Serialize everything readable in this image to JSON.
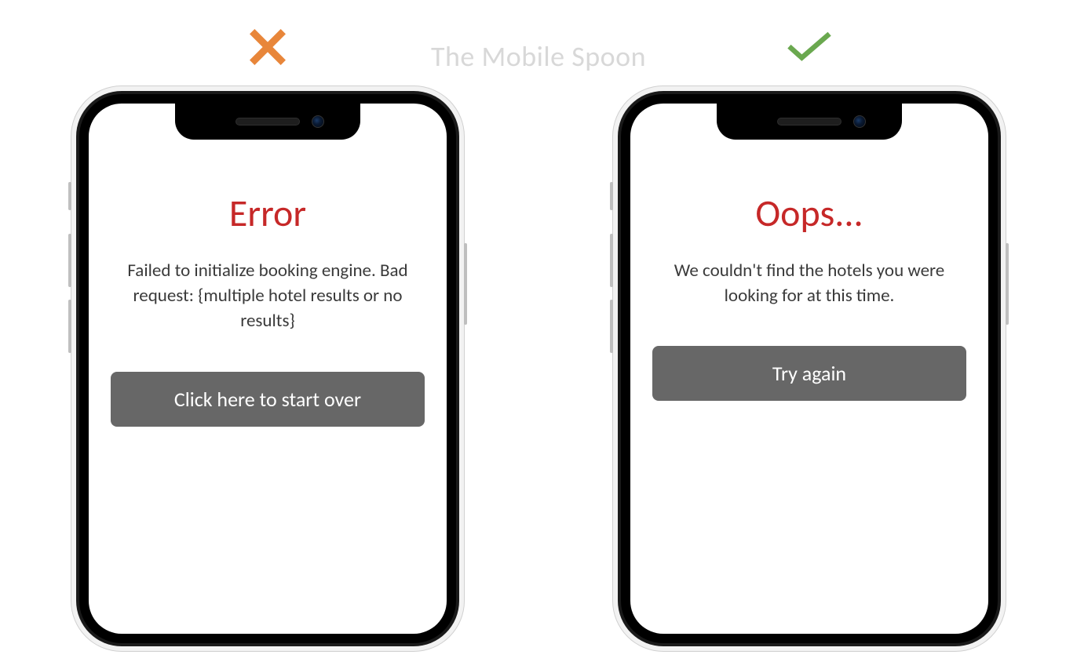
{
  "watermark": "The Mobile Spoon",
  "left": {
    "title": "Error",
    "message": "Failed to initialize booking engine. Bad request: {multiple hotel results or no results}",
    "button_label": "Click here to start over"
  },
  "right": {
    "title": "Oops...",
    "message": "We couldn't find the hotels you were looking for at this time.",
    "button_label": "Try again"
  },
  "colors": {
    "error_title": "#c62828",
    "button_bg": "#676767",
    "cross": "#e8863a",
    "check": "#6aa84f"
  }
}
